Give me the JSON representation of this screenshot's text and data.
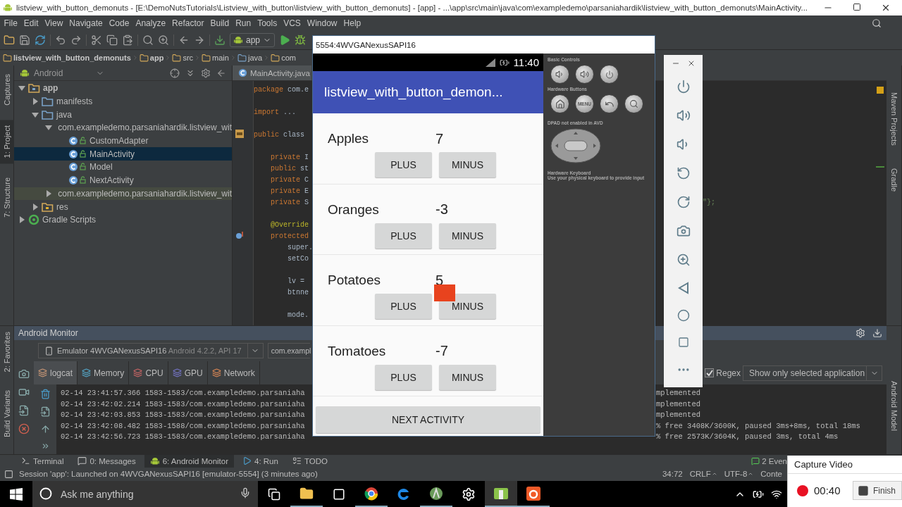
{
  "window": {
    "title": "listview_with_button_demonuts - [E:\\DemoNutsTutorials\\Listview_with_button\\listview_with_button_demonuts] - [app] - ...\\app\\src\\main\\java\\com\\exampledemo\\parsaniahardik\\listview_with_button_demonuts\\MainActivity..."
  },
  "menu": [
    "File",
    "Edit",
    "View",
    "Navigate",
    "Code",
    "Analyze",
    "Refactor",
    "Build",
    "Run",
    "Tools",
    "VCS",
    "Window",
    "Help"
  ],
  "toolbar": {
    "run_config": "app"
  },
  "breadcrumbs": [
    "listview_with_button_demonuts",
    "app",
    "src",
    "main",
    "java",
    "com"
  ],
  "left_tool_tabs": [
    {
      "label": "Captures",
      "selected": false
    },
    {
      "label": "1: Project",
      "selected": true
    },
    {
      "label": "7: Structure",
      "selected": false
    }
  ],
  "project": {
    "view": "Android",
    "tree": [
      {
        "label": "app",
        "kind": "module",
        "expanded": true,
        "selected": false,
        "children": [
          {
            "label": "manifests",
            "kind": "folder",
            "expanded": false,
            "selected": false
          },
          {
            "label": "java",
            "kind": "folder",
            "expanded": true,
            "selected": false,
            "children": [
              {
                "label": "com.exampledemo.parsaniahardik.listview_wit",
                "kind": "package",
                "expanded": true,
                "selected": false,
                "children": [
                  {
                    "label": "CustomAdapter",
                    "kind": "class",
                    "selected": false
                  },
                  {
                    "label": "MainActivity",
                    "kind": "class",
                    "selected": true
                  },
                  {
                    "label": "Model",
                    "kind": "class",
                    "selected": false
                  },
                  {
                    "label": "NextActivity",
                    "kind": "class",
                    "selected": false
                  }
                ]
              },
              {
                "label": "com.exampledemo.parsaniahardik.listview_wit",
                "kind": "test-package",
                "expanded": false,
                "selected": false
              }
            ]
          },
          {
            "label": "res",
            "kind": "resources",
            "expanded": false,
            "selected": false
          }
        ]
      },
      {
        "label": "Gradle Scripts",
        "kind": "gradle",
        "expanded": false,
        "selected": false
      }
    ]
  },
  "editor": {
    "tab": "MainActivity.java",
    "code_blocks": [
      [
        {
          "text": "package com.e",
          "kind": "keyword"
        }
      ],
      [
        {
          "text": "import ...",
          "kind": "keyword"
        }
      ],
      [
        {
          "text": "public class ",
          "kind": "keyword"
        }
      ],
      [
        {
          "text": "    private I",
          "kind": "keyword"
        },
        {
          "text": "    public st",
          "kind": "keyword"
        },
        {
          "text": "    private C",
          "kind": "keyword"
        },
        {
          "text": "    private E",
          "kind": "keyword"
        },
        {
          "text": "    private S",
          "kind": "keyword",
          "tail": "\"};"
        }
      ],
      [
        {
          "text": "    @Override",
          "kind": "annotation"
        },
        {
          "text": "    protected",
          "kind": "keyword"
        },
        {
          "text": "        super.",
          "kind": "plain"
        },
        {
          "text": "        setCo",
          "kind": "plain"
        }
      ],
      [
        {
          "text": "        lv =",
          "kind": "plain"
        },
        {
          "text": "        btnne",
          "kind": "plain"
        }
      ],
      [
        {
          "text": "        mode.",
          "kind": "plain"
        }
      ]
    ]
  },
  "right_tool_tabs": [
    "Maven Projects",
    "Gradle"
  ],
  "bottom_left_tool_tabs": [
    "2: Favorites",
    "Build Variants"
  ],
  "bottom_right_tool_tabs": [
    "Android Model"
  ],
  "android_monitor": {
    "title": "Android Monitor",
    "device": "Emulator 4WVGANexusSAPI16",
    "device_detail": "Android 4.2.2, API 17",
    "process": "com.exampl",
    "tabs": [
      {
        "label": "logcat",
        "selected": true
      },
      {
        "label": "Memory",
        "selected": false
      },
      {
        "label": "CPU",
        "selected": false
      },
      {
        "label": "GPU",
        "selected": false
      },
      {
        "label": "Network",
        "selected": false
      }
    ],
    "regex": {
      "label": "Regex",
      "checked": true
    },
    "filter": "Show only selected application",
    "log_lines": [
      {
        "left": "02-14 23:41:57.366 1583-1583/com.exampledemo.parsaniaha",
        "right": "mplemented"
      },
      {
        "left": "02-14 23:42:02.214 1583-1583/com.exampledemo.parsaniaha",
        "right": "mplemented"
      },
      {
        "left": "02-14 23:42:03.853 1583-1583/com.exampledemo.parsaniaha",
        "right": "mplemented"
      },
      {
        "left": "02-14 23:42:08.482 1583-1588/com.exampledemo.parsaniaha",
        "right": "% free 3408K/3600K, paused 3ms+8ms, total 18ms"
      },
      {
        "left": "02-14 23:42:56.723 1583-1583/com.exampledemo.parsaniaha",
        "right": "% free 2573K/3604K, paused 3ms, total 4ms"
      }
    ]
  },
  "bottom_tabs": [
    {
      "label": "Terminal",
      "kind": "terminal",
      "selected": false
    },
    {
      "label": "0: Messages",
      "kind": "messages",
      "selected": false
    },
    {
      "label": "6: Android Monitor",
      "kind": "android",
      "selected": true
    },
    {
      "label": "4: Run",
      "kind": "run",
      "selected": false
    },
    {
      "label": "TODO",
      "kind": "todo",
      "selected": false
    }
  ],
  "event_log": {
    "count": "2",
    "label": "Even"
  },
  "status_bar": {
    "message": "Session 'app': Launched on 4WVGANexusSAPI16 [emulator-5554] (3 minutes ago)",
    "position": "34:72",
    "line_separator": "CRLF",
    "encoding": "UTF-8",
    "context": "Conte"
  },
  "emulator": {
    "title": "5554:4WVGANexusSAPI16",
    "clock": "11:40",
    "app_title": "listview_with_button_demon...",
    "items": [
      {
        "name": "Apples",
        "count": "7",
        "plus": "PLUS",
        "minus": "MINUS"
      },
      {
        "name": "Oranges",
        "count": "-3",
        "plus": "PLUS",
        "minus": "MINUS"
      },
      {
        "name": "Potatoes",
        "count": "5",
        "plus": "PLUS",
        "minus": "MINUS"
      },
      {
        "name": "Tomatoes",
        "count": "-7",
        "plus": "PLUS",
        "minus": "MINUS"
      }
    ],
    "next_button": "NEXT ACTIVITY",
    "controls": {
      "basic_controls": "Basic Controls",
      "hardware_buttons": "Hardware Buttons",
      "menu_key": "MENU",
      "dpad_note": "DPAD not enabled in AVD",
      "keyboard_title": "Hardware Keyboard",
      "keyboard_note": "Use your physical keyboard to provide input"
    }
  },
  "taskbar": {
    "search_placeholder": "Ask me anything"
  },
  "capture_video": {
    "title": "Capture Video",
    "time": "00:40",
    "finish": "Finish"
  }
}
